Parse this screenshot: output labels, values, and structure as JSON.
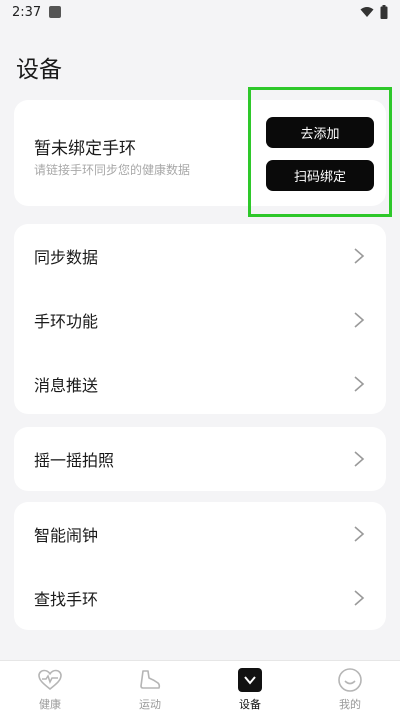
{
  "status_bar": {
    "time": "2:37"
  },
  "page_title": "设备",
  "bind_card": {
    "title": "暂未绑定手环",
    "subtitle": "请链接手环同步您的健康数据",
    "add_button": "去添加",
    "scan_button": "扫码绑定"
  },
  "menu": {
    "sync_data": "同步数据",
    "band_functions": "手环功能",
    "message_push": "消息推送",
    "shake_photo": "摇一摇拍照",
    "smart_alarm": "智能闹钟",
    "find_band": "查找手环"
  },
  "nav": {
    "health": "健康",
    "sport": "运动",
    "device": "设备",
    "mine": "我的"
  },
  "colors": {
    "highlight": "#2ec82a",
    "button_bg": "#0a0a0a",
    "page_bg": "#f4f4f6"
  }
}
